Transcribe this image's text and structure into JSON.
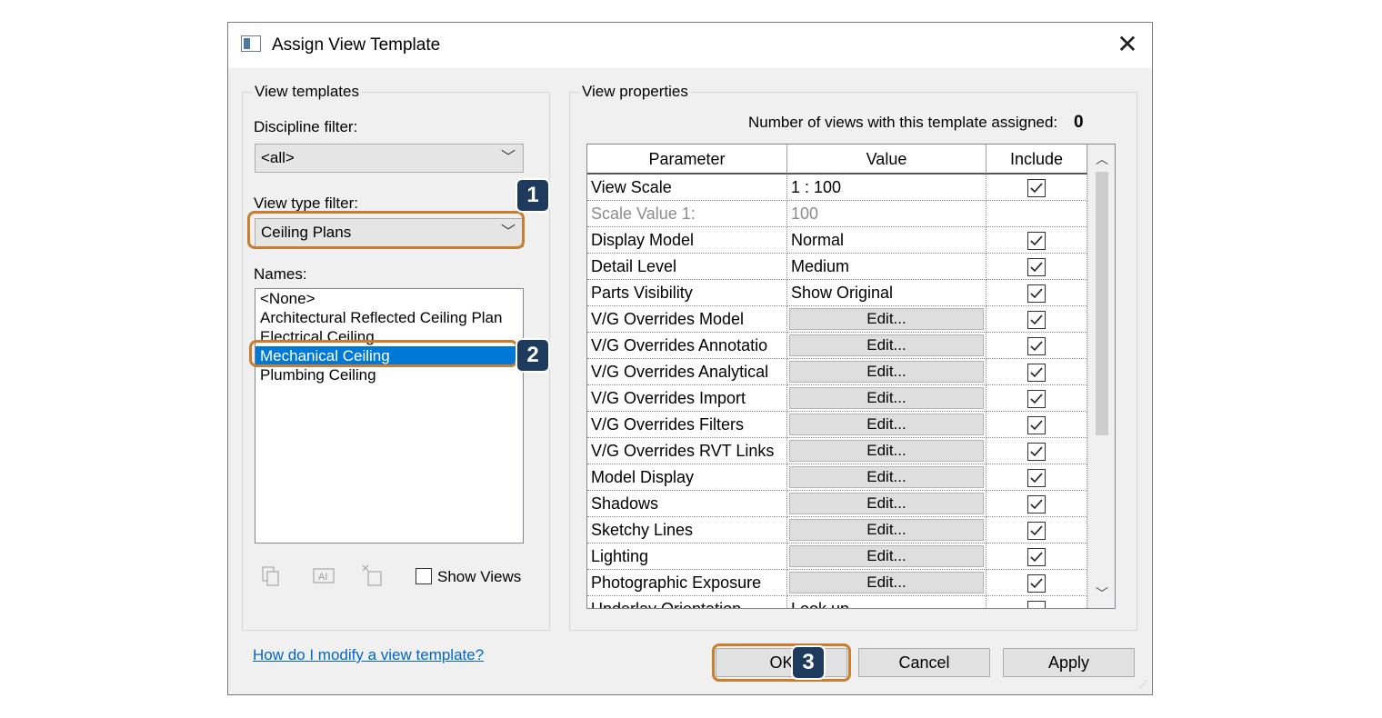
{
  "window": {
    "title": "Assign View Template",
    "close_label": "✕"
  },
  "left_panel": {
    "group_title": "View templates",
    "discipline_filter_label": "Discipline filter:",
    "discipline_filter_value": "<all>",
    "view_type_filter_label": "View type filter:",
    "view_type_filter_value": "Ceiling Plans",
    "names_label": "Names:",
    "names": [
      "<None>",
      "Architectural Reflected Ceiling Plan",
      "Electrical Ceiling",
      "Mechanical Ceiling",
      "Plumbing Ceiling"
    ],
    "selected_name": "Mechanical Ceiling",
    "show_views_label": "Show Views",
    "show_views_checked": false,
    "icons": [
      "duplicate-icon",
      "rename-icon",
      "delete-icon"
    ]
  },
  "right_panel": {
    "group_title": "View properties",
    "views_assigned_label": "Number of views with this template assigned:",
    "views_assigned_count": "0",
    "columns": [
      "Parameter",
      "Value",
      "Include"
    ],
    "rows": [
      {
        "parameter": "View Scale",
        "value": "1 : 100",
        "type": "text",
        "include": true
      },
      {
        "parameter": "Scale Value    1:",
        "value": "100",
        "type": "text",
        "include": null,
        "disabled": true
      },
      {
        "parameter": "Display Model",
        "value": "Normal",
        "type": "text",
        "include": true
      },
      {
        "parameter": "Detail Level",
        "value": "Medium",
        "type": "text",
        "include": true
      },
      {
        "parameter": "Parts Visibility",
        "value": "Show Original",
        "type": "text",
        "include": true
      },
      {
        "parameter": "V/G Overrides Model",
        "value": "Edit...",
        "type": "button",
        "include": true
      },
      {
        "parameter": "V/G Overrides Annotatio",
        "value": "Edit...",
        "type": "button",
        "include": true
      },
      {
        "parameter": "V/G Overrides Analytical",
        "value": "Edit...",
        "type": "button",
        "include": true
      },
      {
        "parameter": "V/G Overrides Import",
        "value": "Edit...",
        "type": "button",
        "include": true
      },
      {
        "parameter": "V/G Overrides Filters",
        "value": "Edit...",
        "type": "button",
        "include": true
      },
      {
        "parameter": "V/G Overrides RVT Links",
        "value": "Edit...",
        "type": "button",
        "include": true
      },
      {
        "parameter": "Model Display",
        "value": "Edit...",
        "type": "button",
        "include": true
      },
      {
        "parameter": "Shadows",
        "value": "Edit...",
        "type": "button",
        "include": true
      },
      {
        "parameter": "Sketchy Lines",
        "value": "Edit...",
        "type": "button",
        "include": true
      },
      {
        "parameter": "Lighting",
        "value": "Edit...",
        "type": "button",
        "include": true
      },
      {
        "parameter": "Photographic Exposure",
        "value": "Edit...",
        "type": "button",
        "include": true
      },
      {
        "parameter": "Underlay Orientation",
        "value": "Look up",
        "type": "text",
        "include": false
      }
    ]
  },
  "footer": {
    "help_link": "How do I modify a view template?",
    "ok_label": "OK",
    "cancel_label": "Cancel",
    "apply_label": "Apply"
  },
  "callouts": [
    "1",
    "2",
    "3"
  ],
  "colors": {
    "highlight": "#c97d2e",
    "badge": "#1e3a5c",
    "selection": "#0078d7",
    "link": "#0066cc"
  }
}
